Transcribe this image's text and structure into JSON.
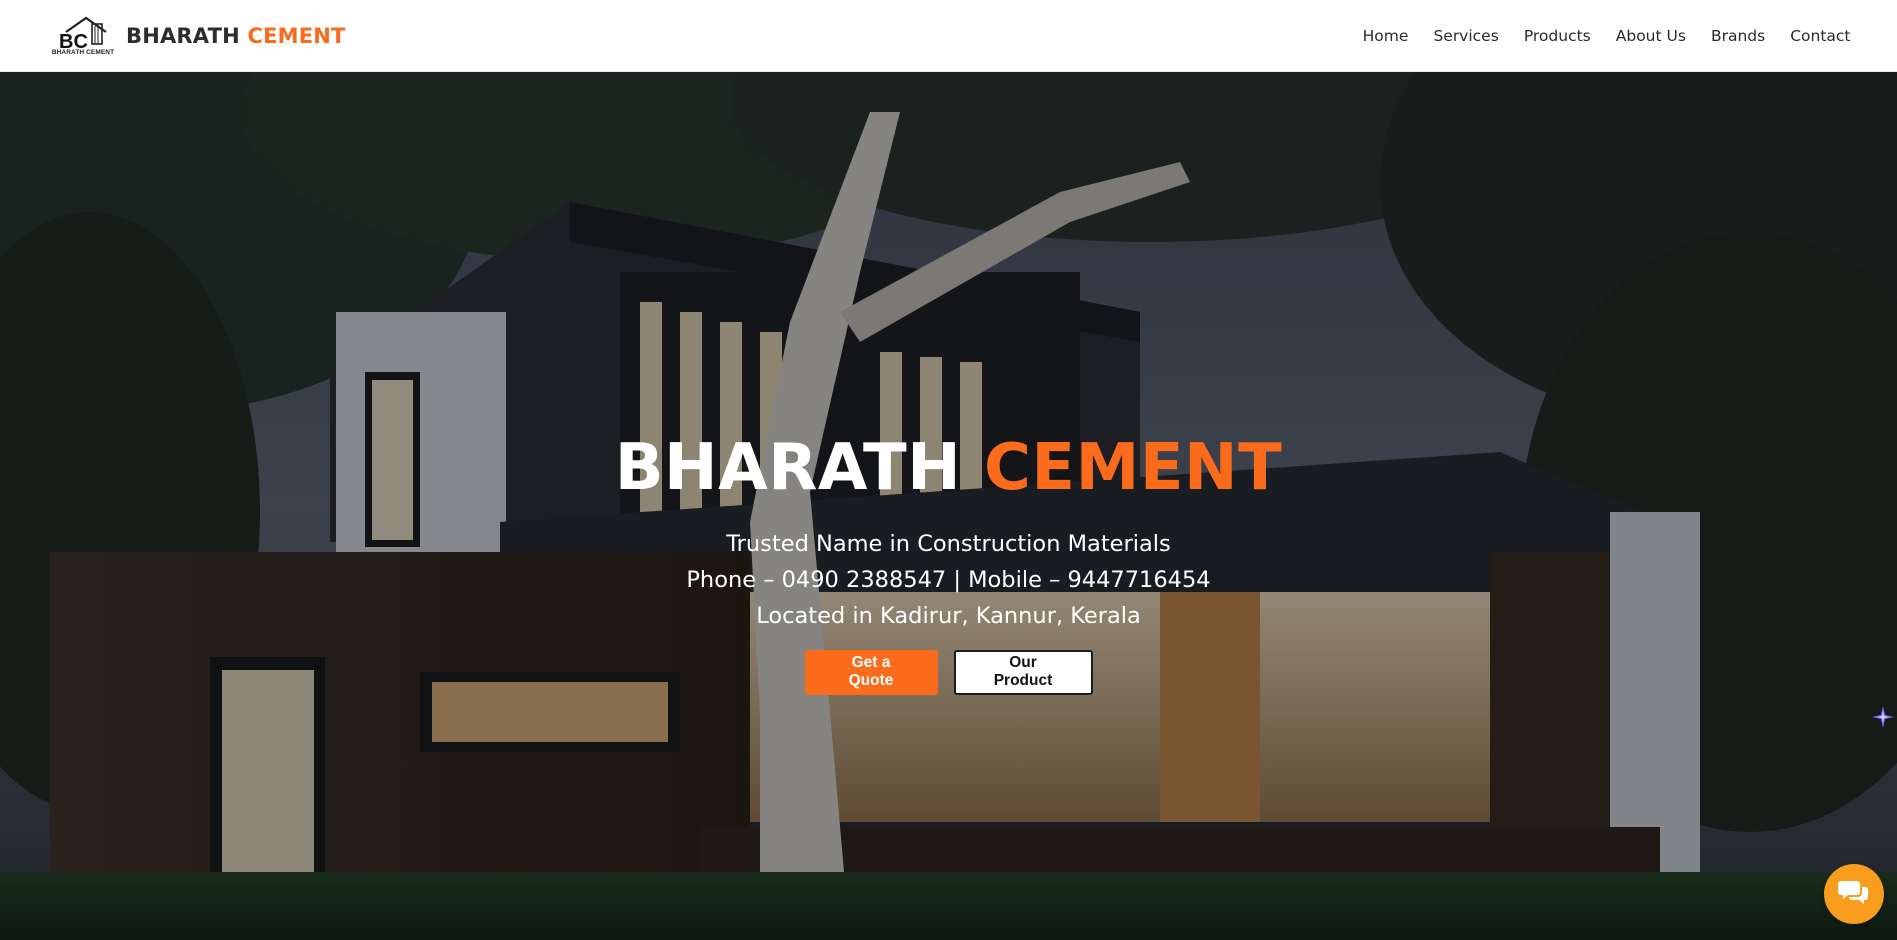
{
  "header": {
    "logo_text": "BC",
    "logo_caption": "BHARATH CEMENT",
    "brand_name": "BHARATH",
    "brand_accent": "CEMENT",
    "nav": [
      "Home",
      "Services",
      "Products",
      "About Us",
      "Brands",
      "Contact"
    ]
  },
  "hero": {
    "title": "BHARATH",
    "title_accent": "CEMENT",
    "tagline": "Trusted Name in Construction Materials",
    "contact": "Phone – 0490 2388547 | Mobile – 9447716454",
    "location": "Located in Kadirur, Kannur, Kerala",
    "primary_button": "Get a Quote",
    "secondary_button": "Our Product"
  },
  "widgets": {
    "chat_icon": "chat-bubbles-icon",
    "sparkle_icon": "sparkle-icon"
  },
  "colors": {
    "accent": "#fb6b1c",
    "chat": "#f99d1c",
    "nav_text": "#2b2b2b"
  }
}
